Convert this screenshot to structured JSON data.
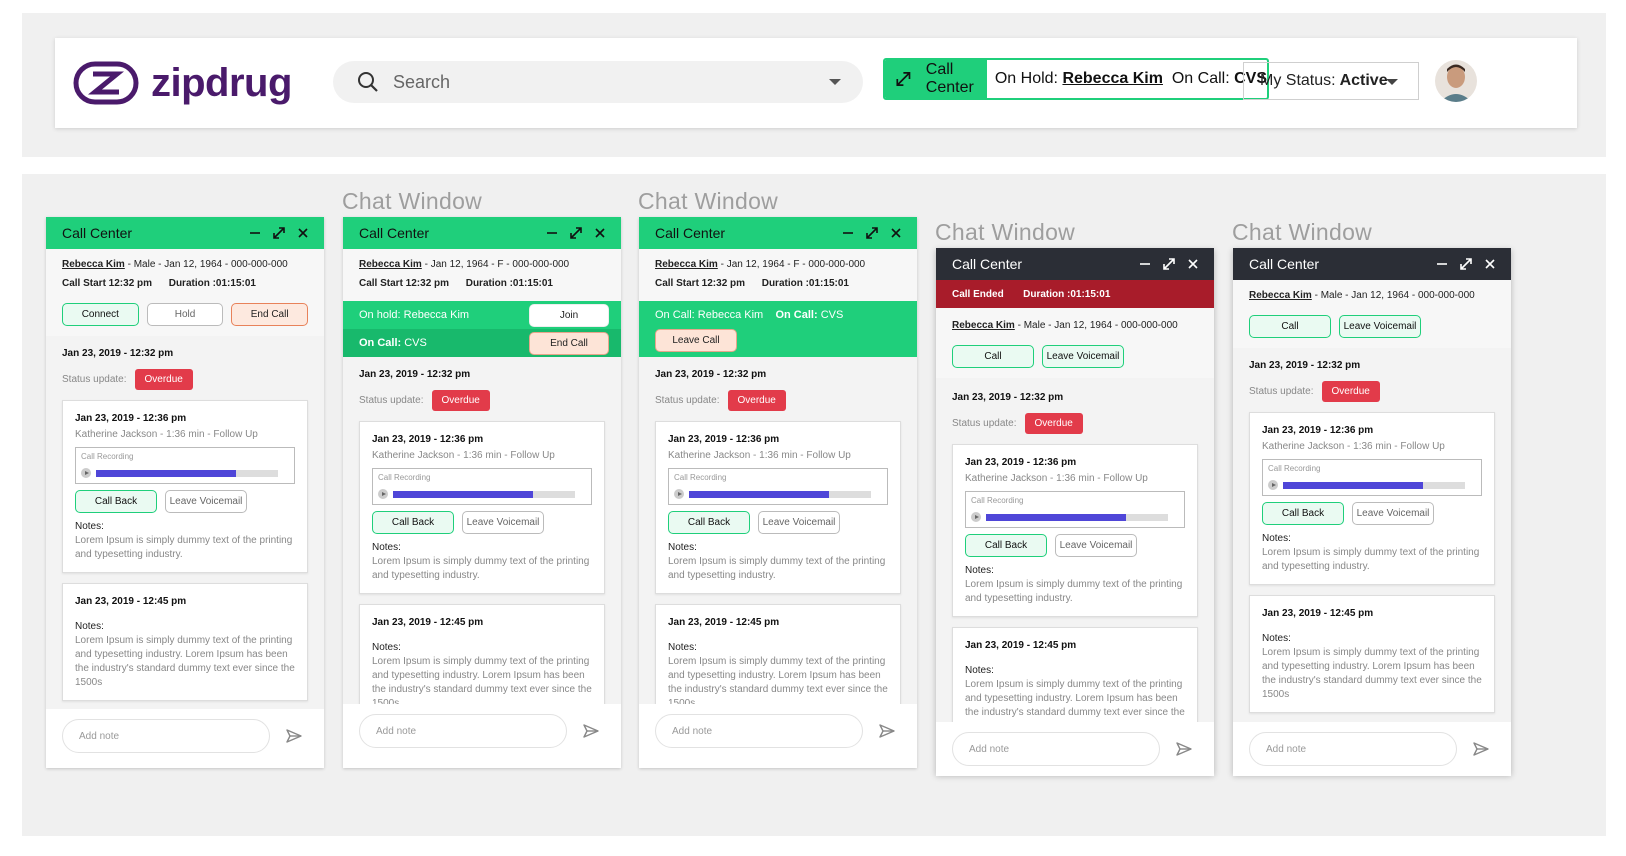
{
  "header": {
    "logo_text": "zipdrug",
    "search_placeholder": "Search",
    "call_center_label": "Call Center",
    "on_hold_prefix": "On Hold:",
    "on_hold_name": "Rebecca Kim",
    "on_call_prefix": "On Call:",
    "on_call_name": "CVS",
    "status_prefix": "My Status:",
    "status_value": "Active"
  },
  "chat_window_label": "Chat Window",
  "common": {
    "title": "Call Center",
    "patient_name": "Rebecca Kim",
    "patient_details_male": " - Male - Jan 12, 1964 - 000-000-000",
    "patient_details_female": " - Jan 12, 1964 - F - 000-000-000",
    "call_start": "Call Start 12:32 pm",
    "duration": "Duration :01:15:01",
    "entry_date": "Jan 23, 2019 - 12:32 pm",
    "status_update": "Status update:",
    "overdue": "Overdue",
    "card1_date": "Jan 23, 2019 - 12:36 pm",
    "card1_sub": "Katherine Jackson - 1:36 min - Follow Up",
    "call_recording": "Call Recording",
    "recording_progress": 0.77,
    "call_back": "Call Back",
    "leave_voicemail": "Leave Voicemail",
    "notes_label": "Notes:",
    "notes_short": "Lorem Ipsum is simply dummy text of the printing and typesetting industry.",
    "card2_date": "Jan 23, 2019 - 12:45 pm",
    "notes_long": "Lorem Ipsum is simply dummy text of the printing and typesetting industry. Lorem Ipsum has been the industry's standard dummy text ever since the 1500s",
    "add_note": "Add note"
  },
  "panel1": {
    "connect": "Connect",
    "hold": "Hold",
    "end_call": "End Call"
  },
  "panel2": {
    "on_hold_text": "On hold: Rebecca Kim",
    "join": "Join",
    "on_call_label": "On Call:",
    "on_call_value": "CVS",
    "end_call": "End Call"
  },
  "panel3": {
    "on_call_text": "On Call: Rebecca Kim",
    "on_call_label2": "On Call:",
    "on_call_value2": "CVS",
    "leave_call": "Leave Call"
  },
  "panel4": {
    "call_ended": "Call Ended",
    "call": "Call",
    "leave_voicemail": "Leave Voicemail"
  },
  "panel5": {
    "call": "Call",
    "leave_voicemail": "Leave Voicemail"
  },
  "colors": {
    "brand_green": "#1fcf7b",
    "overdue_red": "#e23b4a",
    "dark_header": "#2b2e36",
    "ended_red": "#a81c2a",
    "logo_purple": "#4a1a6b"
  }
}
